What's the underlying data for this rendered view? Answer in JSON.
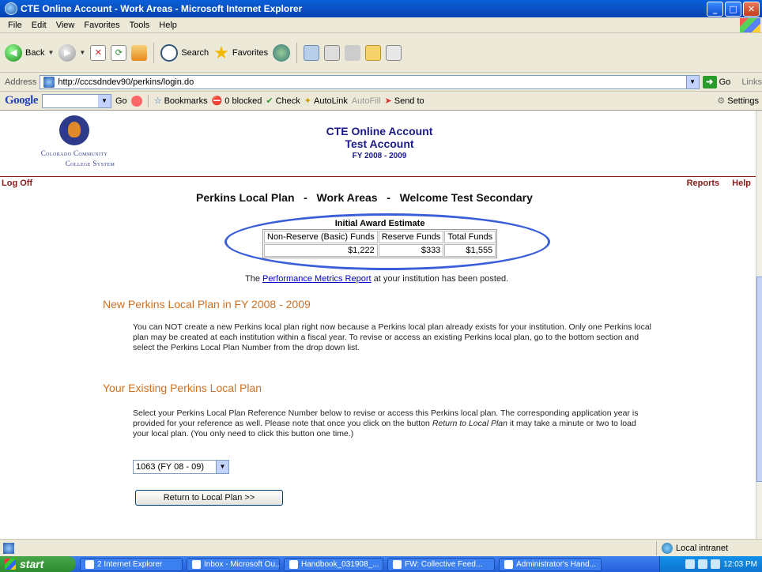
{
  "window": {
    "title": "CTE Online Account - Work Areas - Microsoft Internet Explorer",
    "controls": [
      "_",
      "□",
      "✕"
    ]
  },
  "menu": [
    "File",
    "Edit",
    "View",
    "Favorites",
    "Tools",
    "Help"
  ],
  "toolbar": {
    "back_label": "Back",
    "search_label": "Search",
    "favorites_label": "Favorites"
  },
  "address": {
    "label": "Address",
    "url": "http://cccsdndev90/perkins/login.do",
    "go_label": "Go",
    "links_label": "Links"
  },
  "google_bar": {
    "logo": "Google",
    "go": "Go",
    "bookmarks": "Bookmarks",
    "blocked": "0 blocked",
    "check": "Check",
    "autolink": "AutoLink",
    "autofill": "AutoFill",
    "send_to": "Send to",
    "settings": "Settings"
  },
  "page": {
    "logo_line1": "Colorado Community",
    "logo_line2": "College System",
    "header_title": "CTE Online Account",
    "header_subtitle": "Test Account",
    "header_fy": "FY 2008 - 2009",
    "log_off": "Log Off",
    "reports": "Reports",
    "help": "Help",
    "title_plan": "Perkins Local Plan",
    "title_sep": "-",
    "title_work": "Work Areas",
    "title_welcome": "Welcome Test Secondary",
    "award": {
      "caption": "Initial Award Estimate",
      "headers": [
        "Non-Reserve (Basic) Funds",
        "Reserve Funds",
        "Total Funds"
      ],
      "values": [
        "$1,222",
        "$333",
        "$1,555"
      ]
    },
    "metrics_prefix": "The ",
    "metrics_link": "Performance Metrics Report",
    "metrics_suffix": " at your institution has been posted.",
    "new_plan_title": "New Perkins Local Plan in FY 2008 - 2009",
    "new_plan_text": "You can NOT create a new Perkins local plan right now because a Perkins local plan already exists for your institution. Only one Perkins local plan may be created at each institution within a fiscal year. To revise or access an existing Perkins local plan, go to the bottom section and select the Perkins Local Plan Number from the drop down list.",
    "existing_title": "Your Existing Perkins Local Plan",
    "existing_text_1": "Select your Perkins Local Plan Reference Number below to revise or access this Perkins local plan. The corresponding application year is provided for your reference as well. Please note that once you click on the button ",
    "existing_text_em": "Return to Local Plan",
    "existing_text_2": " it may take a minute or two to load your local plan. (You only need to click this button one time.)",
    "plan_select_value": "1063 (FY 08 - 09)",
    "return_button": "Return to Local Plan >>"
  },
  "status": {
    "zone": "Local intranet"
  },
  "taskbar": {
    "start": "start",
    "tasks": [
      "2 Internet Explorer",
      "Inbox - Microsoft Ou...",
      "Handbook_031908_...",
      "FW: Collective Feed...",
      "Administrator's Hand..."
    ],
    "clock": "12:03 PM"
  },
  "colors": {
    "accent_orange": "#d07020",
    "header_blue": "#1a1a8a",
    "link_red": "#8b1a1a",
    "highlight_oval": "#3a5fd8"
  }
}
